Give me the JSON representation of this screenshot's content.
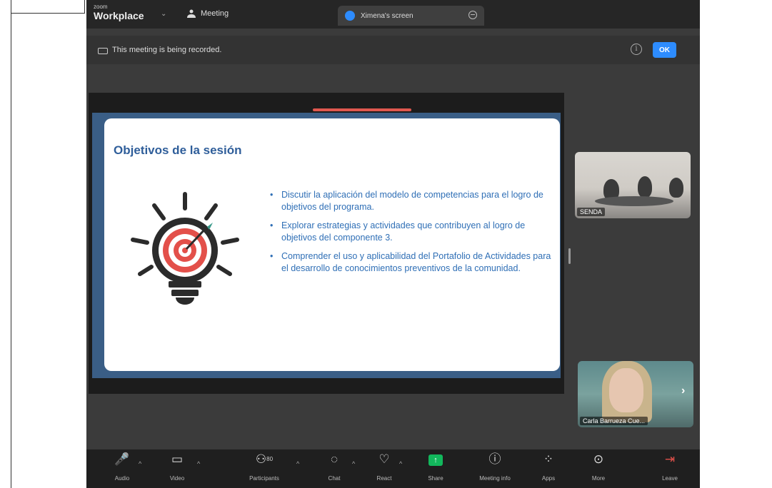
{
  "app": {
    "brand_small": "zoom",
    "brand_name": "Workplace",
    "meeting_tab": "Meeting",
    "screen_tab": "Ximena's screen"
  },
  "recording": {
    "text": "This meeting is being recorded.",
    "ok_label": "OK",
    "info_glyph": "i"
  },
  "slide": {
    "title": "Objetivos de la sesión",
    "bullets": [
      "Discutir la aplicación del modelo de competencias para el logro de objetivos del programa.",
      "Explorar estrategias y actividades que contribuyen al logro de objetivos del componente 3.",
      "Comprender el uso y aplicabilidad del Portafolio de Actividades para el desarrollo de conocimientos preventivos de la comunidad."
    ]
  },
  "participants_tiles": [
    {
      "name": "SENDA"
    },
    {
      "name": "Carla Barrueza Cue..."
    }
  ],
  "toolbar": {
    "audio": "Audio",
    "video": "Video",
    "participants": "Participants",
    "participants_count": "80",
    "chat": "Chat",
    "react": "React",
    "share": "Share",
    "meeting_info": "Meeting info",
    "apps": "Apps",
    "more": "More",
    "leave": "Leave"
  },
  "icons": {
    "meeting": "meeting-icon",
    "screen": "screen-share-icon",
    "record": "recording-icon",
    "info": "info-icon",
    "audio": "mic-muted-icon",
    "video": "camera-icon",
    "participants": "people-icon",
    "chat": "chat-icon",
    "react": "heart-icon",
    "share": "share-screen-icon",
    "meeting_info": "info-circle-icon",
    "apps": "apps-icon",
    "more": "more-icon",
    "leave": "leave-icon"
  },
  "colors": {
    "accent": "#2d8cff",
    "share": "#12b75c",
    "danger": "#e0504a",
    "slide_title": "#2f5e9a",
    "slide_text": "#2f6fb6"
  }
}
